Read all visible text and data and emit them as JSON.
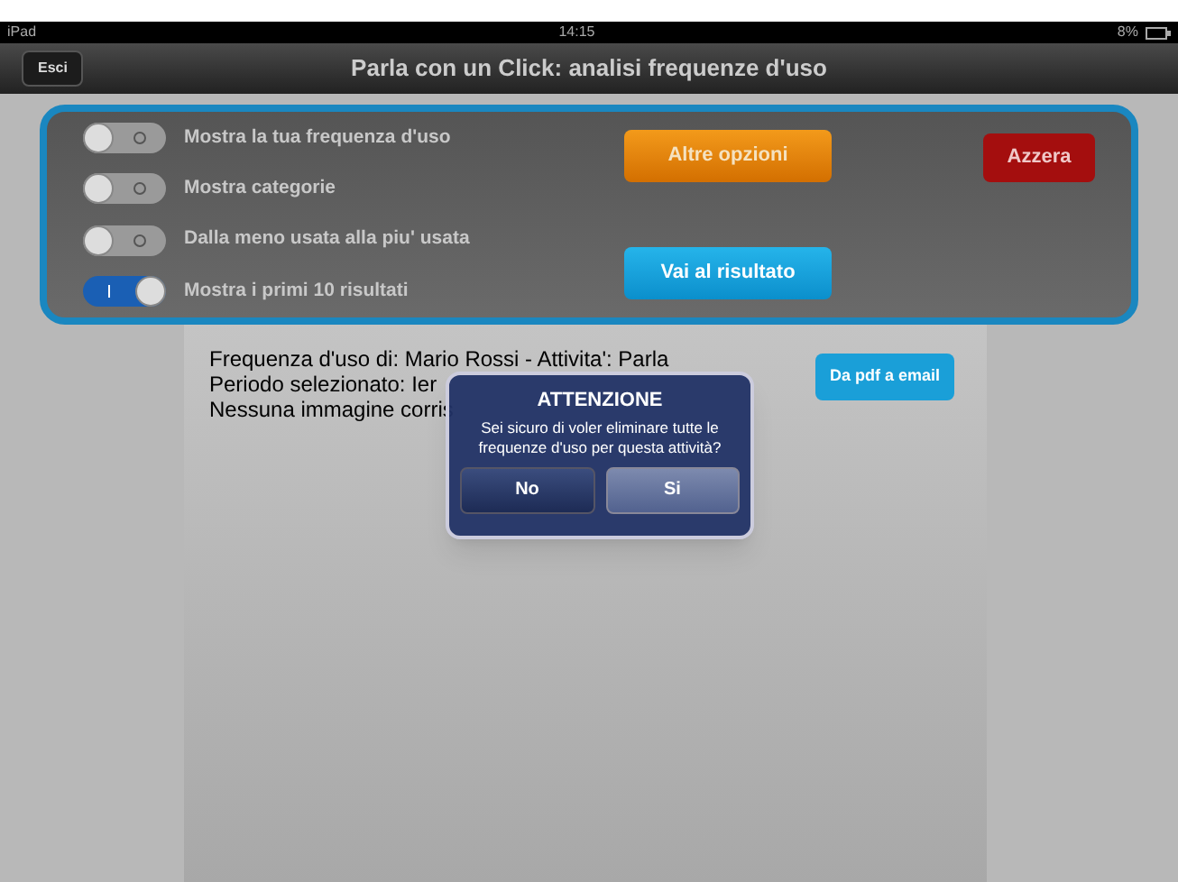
{
  "status_bar": {
    "device": "iPad",
    "time": "14:15",
    "battery": "8%"
  },
  "nav_bar": {
    "back_button": "Esci",
    "title": "Parla con un Click: analisi frequenze d'uso"
  },
  "options": [
    {
      "label": "Mostra la tua frequenza d'uso",
      "on": false
    },
    {
      "label": "Mostra categorie",
      "on": false
    },
    {
      "label": "Dalla meno usata alla piu' usata",
      "on": false
    },
    {
      "label": "Mostra i primi 10 risultati",
      "on": true
    }
  ],
  "buttons": [
    {
      "label": "Altre opzioni",
      "kind": "orange"
    },
    {
      "label": "Vai al risultato",
      "kind": "blue"
    },
    {
      "label": "Azzera",
      "kind": "red"
    }
  ],
  "report": {
    "lines": [
      "Frequenza d'uso di: Mario Rossi - Attivita': Parla",
      "Periodo selezionato: Ier",
      "Nessuna immagine corris"
    ],
    "export_button": "Da pdf a email"
  },
  "alert": {
    "title": "ATTENZIONE",
    "message": "Sei sicuro di voler eliminare tutte le frequenze d'uso per questa attività?",
    "buttons": [
      "No",
      "Si"
    ]
  }
}
